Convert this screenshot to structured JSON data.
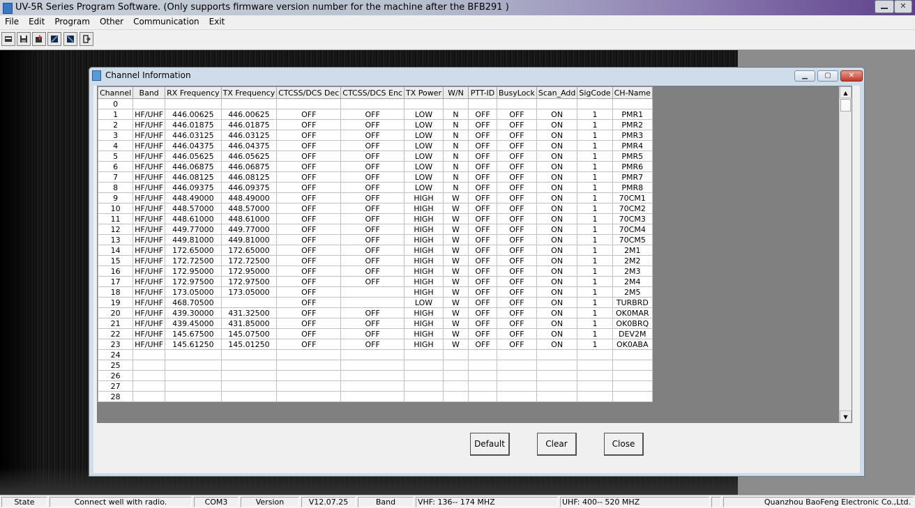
{
  "app": {
    "title": "UV-5R Series Program Software. (Only supports firmware version number for the machine after the BFB291 )",
    "close_glyph": "✕"
  },
  "menu": [
    "File",
    "Edit",
    "Program",
    "Other",
    "Communication",
    "Exit"
  ],
  "toolbar": {
    "icons": [
      "open-icon",
      "save-icon",
      "read-radio-icon",
      "write-radio-icon",
      "write-radio-icon-2",
      "exit-icon"
    ]
  },
  "channel_window": {
    "title": "Channel Information",
    "min_glyph": "▁",
    "max_glyph": "▢",
    "close_glyph": "✕",
    "columns": [
      "Channel",
      "Band",
      "RX Frequency",
      "TX Frequency",
      "CTCSS/DCS Dec",
      "CTCSS/DCS Enc",
      "TX Power",
      "W/N",
      "PTT-ID",
      "BusyLock",
      "Scan_Add",
      "SigCode",
      "CH-Name"
    ],
    "rows": [
      [
        "0",
        "",
        "",
        "",
        "",
        "",
        "",
        "",
        "",
        "",
        "",
        "",
        ""
      ],
      [
        "1",
        "HF/UHF",
        "446.00625",
        "446.00625",
        "OFF",
        "OFF",
        "LOW",
        "N",
        "OFF",
        "OFF",
        "ON",
        "1",
        "PMR1"
      ],
      [
        "2",
        "HF/UHF",
        "446.01875",
        "446.01875",
        "OFF",
        "OFF",
        "LOW",
        "N",
        "OFF",
        "OFF",
        "ON",
        "1",
        "PMR2"
      ],
      [
        "3",
        "HF/UHF",
        "446.03125",
        "446.03125",
        "OFF",
        "OFF",
        "LOW",
        "N",
        "OFF",
        "OFF",
        "ON",
        "1",
        "PMR3"
      ],
      [
        "4",
        "HF/UHF",
        "446.04375",
        "446.04375",
        "OFF",
        "OFF",
        "LOW",
        "N",
        "OFF",
        "OFF",
        "ON",
        "1",
        "PMR4"
      ],
      [
        "5",
        "HF/UHF",
        "446.05625",
        "446.05625",
        "OFF",
        "OFF",
        "LOW",
        "N",
        "OFF",
        "OFF",
        "ON",
        "1",
        "PMR5"
      ],
      [
        "6",
        "HF/UHF",
        "446.06875",
        "446.06875",
        "OFF",
        "OFF",
        "LOW",
        "N",
        "OFF",
        "OFF",
        "ON",
        "1",
        "PMR6"
      ],
      [
        "7",
        "HF/UHF",
        "446.08125",
        "446.08125",
        "OFF",
        "OFF",
        "LOW",
        "N",
        "OFF",
        "OFF",
        "ON",
        "1",
        "PMR7"
      ],
      [
        "8",
        "HF/UHF",
        "446.09375",
        "446.09375",
        "OFF",
        "OFF",
        "LOW",
        "N",
        "OFF",
        "OFF",
        "ON",
        "1",
        "PMR8"
      ],
      [
        "9",
        "HF/UHF",
        "448.49000",
        "448.49000",
        "OFF",
        "OFF",
        "HIGH",
        "W",
        "OFF",
        "OFF",
        "ON",
        "1",
        "70CM1"
      ],
      [
        "10",
        "HF/UHF",
        "448.57000",
        "448.57000",
        "OFF",
        "OFF",
        "HIGH",
        "W",
        "OFF",
        "OFF",
        "ON",
        "1",
        "70CM2"
      ],
      [
        "11",
        "HF/UHF",
        "448.61000",
        "448.61000",
        "OFF",
        "OFF",
        "HIGH",
        "W",
        "OFF",
        "OFF",
        "ON",
        "1",
        "70CM3"
      ],
      [
        "12",
        "HF/UHF",
        "449.77000",
        "449.77000",
        "OFF",
        "OFF",
        "HIGH",
        "W",
        "OFF",
        "OFF",
        "ON",
        "1",
        "70CM4"
      ],
      [
        "13",
        "HF/UHF",
        "449.81000",
        "449.81000",
        "OFF",
        "OFF",
        "HIGH",
        "W",
        "OFF",
        "OFF",
        "ON",
        "1",
        "70CM5"
      ],
      [
        "14",
        "HF/UHF",
        "172.65000",
        "172.65000",
        "OFF",
        "OFF",
        "HIGH",
        "W",
        "OFF",
        "OFF",
        "ON",
        "1",
        "2M1"
      ],
      [
        "15",
        "HF/UHF",
        "172.72500",
        "172.72500",
        "OFF",
        "OFF",
        "HIGH",
        "W",
        "OFF",
        "OFF",
        "ON",
        "1",
        "2M2"
      ],
      [
        "16",
        "HF/UHF",
        "172.95000",
        "172.95000",
        "OFF",
        "OFF",
        "HIGH",
        "W",
        "OFF",
        "OFF",
        "ON",
        "1",
        "2M3"
      ],
      [
        "17",
        "HF/UHF",
        "172.97500",
        "172.97500",
        "OFF",
        "OFF",
        "HIGH",
        "W",
        "OFF",
        "OFF",
        "ON",
        "1",
        "2M4"
      ],
      [
        "18",
        "HF/UHF",
        "173.05000",
        "173.05000",
        "OFF",
        "",
        "HIGH",
        "W",
        "OFF",
        "OFF",
        "ON",
        "1",
        "2M5"
      ],
      [
        "19",
        "HF/UHF",
        "468.70500",
        "",
        "OFF",
        "",
        "LOW",
        "W",
        "OFF",
        "OFF",
        "ON",
        "1",
        "TURBRD"
      ],
      [
        "20",
        "HF/UHF",
        "439.30000",
        "431.32500",
        "OFF",
        "OFF",
        "HIGH",
        "W",
        "OFF",
        "OFF",
        "ON",
        "1",
        "OK0MAR"
      ],
      [
        "21",
        "HF/UHF",
        "439.45000",
        "431.85000",
        "OFF",
        "OFF",
        "HIGH",
        "W",
        "OFF",
        "OFF",
        "ON",
        "1",
        "OK0BRQ"
      ],
      [
        "22",
        "HF/UHF",
        "145.67500",
        "145.07500",
        "OFF",
        "OFF",
        "HIGH",
        "W",
        "OFF",
        "OFF",
        "ON",
        "1",
        "DEV2M"
      ],
      [
        "23",
        "HF/UHF",
        "145.61250",
        "145.01250",
        "OFF",
        "OFF",
        "HIGH",
        "W",
        "OFF",
        "OFF",
        "ON",
        "1",
        "OK0ABA"
      ],
      [
        "24",
        "",
        "",
        "",
        "",
        "",
        "",
        "",
        "",
        "",
        "",
        "",
        ""
      ],
      [
        "25",
        "",
        "",
        "",
        "",
        "",
        "",
        "",
        "",
        "",
        "",
        "",
        ""
      ],
      [
        "26",
        "",
        "",
        "",
        "",
        "",
        "",
        "",
        "",
        "",
        "",
        "",
        ""
      ],
      [
        "27",
        "",
        "",
        "",
        "",
        "",
        "",
        "",
        "",
        "",
        "",
        "",
        ""
      ],
      [
        "28",
        "",
        "",
        "",
        "",
        "",
        "",
        "",
        "",
        "",
        "",
        "",
        ""
      ]
    ],
    "scroll_up_glyph": "▲",
    "scroll_down_glyph": "▼",
    "buttons": {
      "default": "Default",
      "clear": "Clear",
      "close": "Close"
    }
  },
  "statusbar": {
    "state_label": "State",
    "state_value": "Connect well with radio.",
    "port": "COM3",
    "version_label": "Version",
    "version_value": "V12.07.25",
    "band_label": "Band",
    "vhf": "VHF: 136-- 174 MHZ",
    "uhf": "UHF: 400-- 520 MHZ",
    "company": "Quanzhou BaoFeng Electronic Co.,Ltd."
  }
}
